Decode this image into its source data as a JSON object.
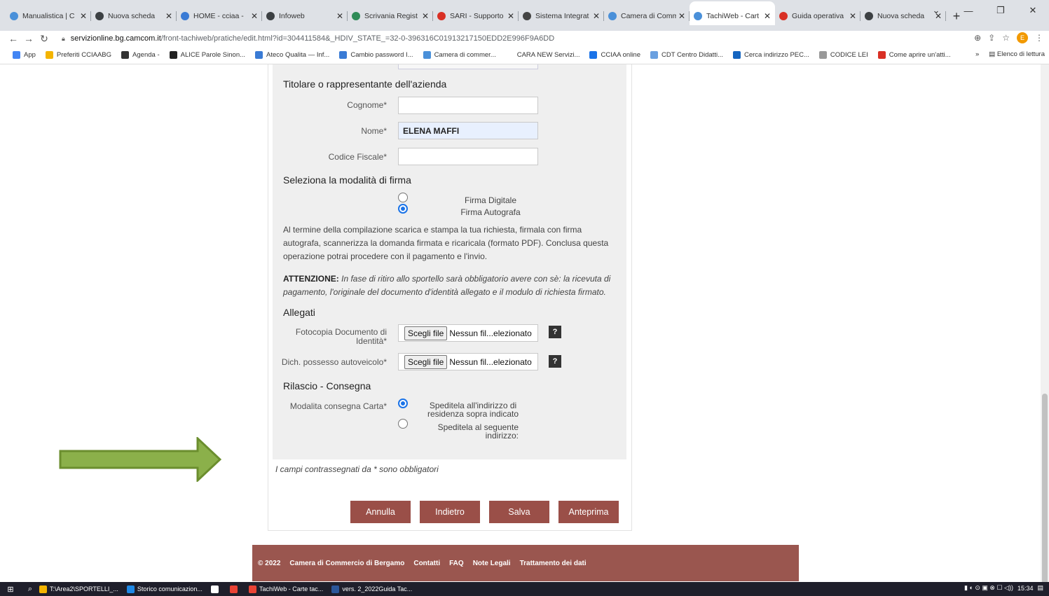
{
  "browser": {
    "tabs": [
      {
        "title": "Manualistica | C",
        "color": "#4a90d9"
      },
      {
        "title": "Nuova scheda",
        "color": "#3c4043"
      },
      {
        "title": "HOME - cciaa -",
        "color": "#3a7bd5"
      },
      {
        "title": "Infoweb",
        "color": "#3c4043"
      },
      {
        "title": "Scrivania Regist",
        "color": "#2e8b57"
      },
      {
        "title": "SARI - Supporto",
        "color": "#d93025"
      },
      {
        "title": "Sistema Integrat",
        "color": "#444"
      },
      {
        "title": "Camera di Comm",
        "color": "#4a90d9"
      },
      {
        "title": "TachiWeb - Cart",
        "color": "#4a90d9",
        "active": true
      },
      {
        "title": "Guida operativa",
        "color": "#d93025"
      },
      {
        "title": "Nuova scheda",
        "color": "#3c4043"
      }
    ],
    "url_host": "servizionline.bg.camcom.it",
    "url_path": "/front-tachiweb/pratiche/edit.html?id=304411584&_HDIV_STATE_=32-0-396316C01913217150EDD2E996F9A6DD",
    "profile_initial": "E",
    "bookmarks": [
      {
        "label": "App",
        "color": "#4285f4"
      },
      {
        "label": "Preferiti CCIAABG",
        "color": "#f4b400"
      },
      {
        "label": "Agenda -",
        "color": "#333"
      },
      {
        "label": "ALICE Parole Sinon...",
        "color": "#222"
      },
      {
        "label": "Ateco Qualita — Inf...",
        "color": "#3a7bd5"
      },
      {
        "label": "Cambio password I...",
        "color": "#3a7bd5"
      },
      {
        "label": "Camera di commer...",
        "color": "#4a90d9"
      },
      {
        "label": "CARA NEW Servizi...",
        "color": "#fff"
      },
      {
        "label": "CCIAA online",
        "color": "#1a73e8"
      },
      {
        "label": "CDT Centro Didatti...",
        "color": "#6aa0e0"
      },
      {
        "label": "Cerca indirizzo PEC...",
        "color": "#1565c0"
      },
      {
        "label": "CODICE LEI",
        "color": "#999"
      },
      {
        "label": "Come aprire un'atti...",
        "color": "#d93025"
      }
    ],
    "bookmarks_more": "»",
    "reading_list": "Elenco di lettura"
  },
  "form": {
    "section_owner": "Titolare o rappresentante dell'azienda",
    "cognome_label": "Cognome*",
    "cognome_value": "",
    "nome_label": "Nome*",
    "nome_value": "ELENA MAFFI",
    "cf_label": "Codice Fiscale*",
    "cf_value": "",
    "section_signature": "Seleziona la modalità di firma",
    "sig_digital": "Firma Digitale",
    "sig_autograph": "Firma Autografa",
    "info_text": "Al termine della compilazione scarica e stampa la tua richiesta, firmala con firma autografa, scannerizza la domanda firmata e ricaricala (formato PDF). Conclusa questa operazione potrai procedere con il pagamento e l'invio.",
    "attention_label": "ATTENZIONE:",
    "attention_text": "In fase di ritiro allo sportello sarà obbligatorio avere con sè: la ricevuta di pagamento, l'originale del documento d'identità allegato e il modulo di richiesta firmato.",
    "section_attachments": "Allegati",
    "doc_label": "Fotocopia Documento di Identità*",
    "dich_label": "Dich. possesso autoveicolo*",
    "file_button": "Scegli file",
    "file_none": "Nessun fil...elezionato",
    "help": "?",
    "section_delivery": "Rilascio - Consegna",
    "delivery_label": "Modalita consegna Carta*",
    "delivery_opt1": "Speditela all'indirizzo di residenza sopra indicato",
    "delivery_opt2": "Speditela al seguente indirizzo:",
    "required_note": "I campi contrassegnati da * sono obbligatori"
  },
  "actions": {
    "cancel": "Annulla",
    "back": "Indietro",
    "save": "Salva",
    "preview": "Anteprima"
  },
  "footer": {
    "copyright": "© 2022",
    "org": "Camera di Commercio di Bergamo",
    "links": [
      "Contatti",
      "FAQ",
      "Note Legali",
      "Trattamento dei dati"
    ]
  },
  "taskbar": {
    "items": [
      {
        "label": "T:\\Area2\\SPORTELLI_...",
        "color": "#f4b400"
      },
      {
        "label": "Storico comunicazion...",
        "color": "#1e88e5"
      },
      {
        "label": "",
        "color": "#fff"
      },
      {
        "label": "",
        "color": "#ea4335"
      },
      {
        "label": "TachiWeb - Carte tac...",
        "color": "#ea4335"
      },
      {
        "label": "vers. 2_2022Guida Tac...",
        "color": "#2b579a"
      }
    ],
    "time": "15:34"
  },
  "colors": {
    "brand_button": "#9a4f48",
    "footer": "#9a564f",
    "arrow": "#8bb04a"
  }
}
